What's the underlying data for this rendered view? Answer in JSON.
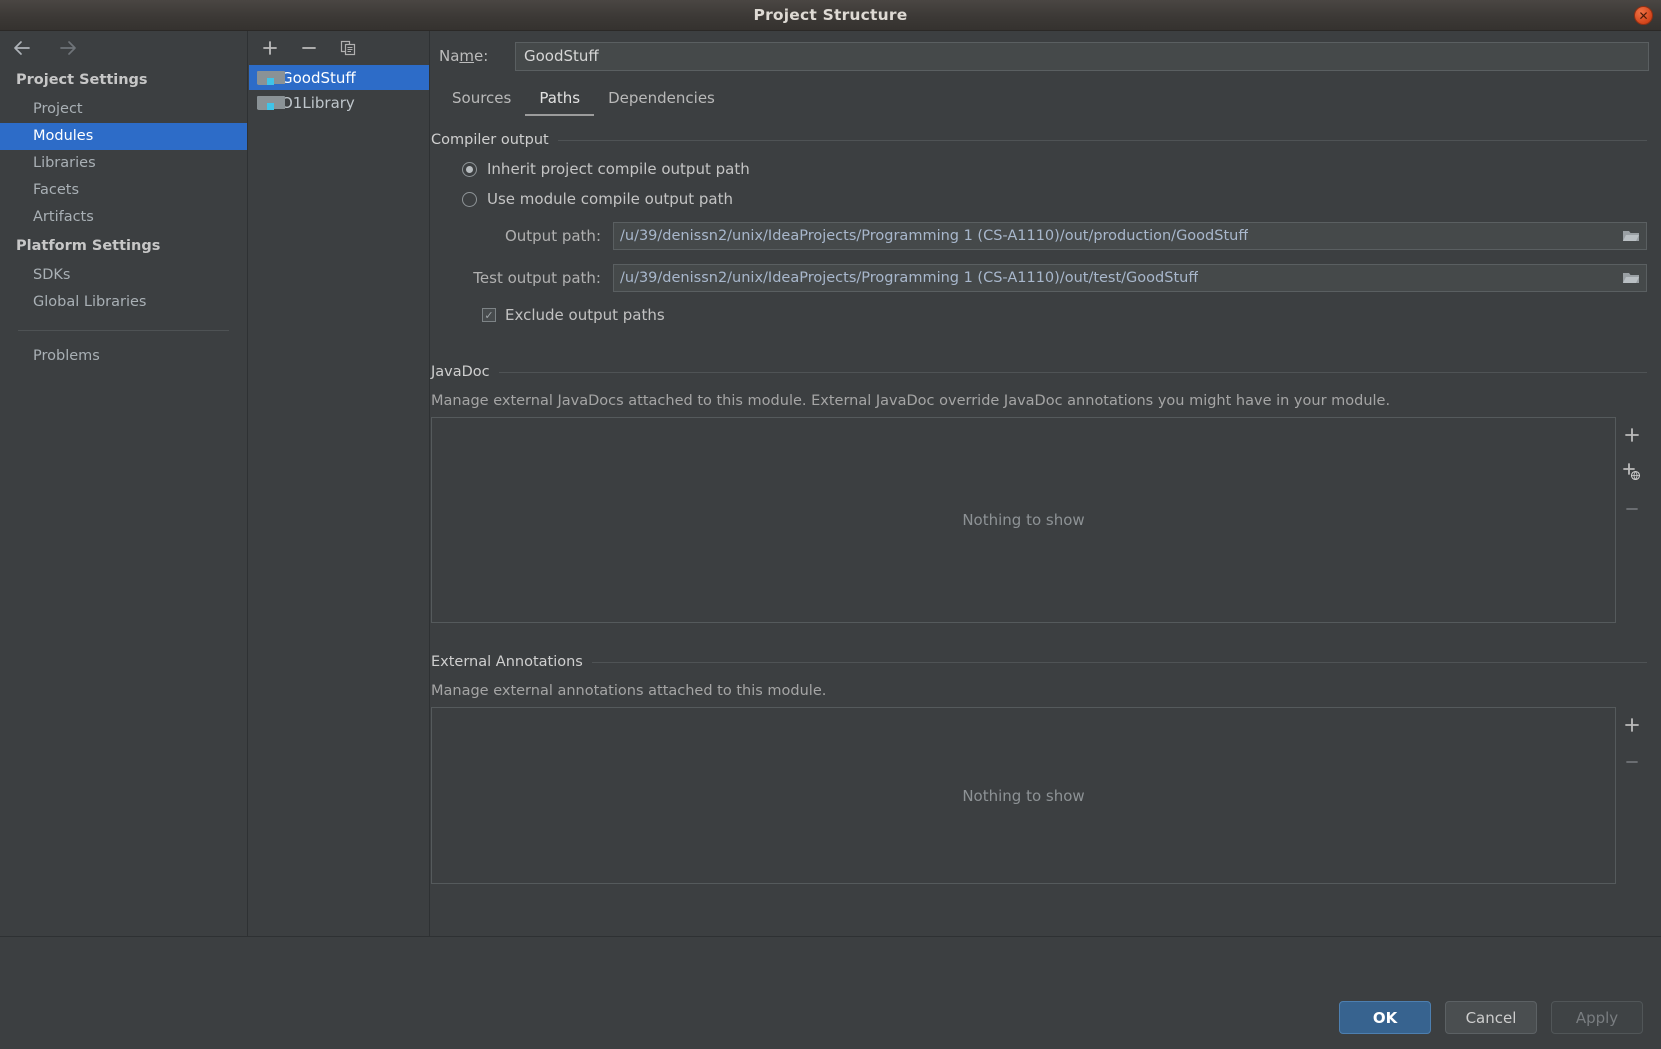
{
  "window": {
    "title": "Project Structure",
    "close_icon": "close-icon"
  },
  "sidebar": {
    "back_icon": "back-arrow-icon",
    "forward_icon": "forward-arrow-icon",
    "groups": [
      {
        "title": "Project Settings",
        "items": [
          "Project",
          "Modules",
          "Libraries",
          "Facets",
          "Artifacts"
        ]
      },
      {
        "title": "Platform Settings",
        "items": [
          "SDKs",
          "Global Libraries"
        ]
      }
    ],
    "extra_items": [
      "Problems"
    ],
    "selected": "Modules",
    "help_label": "?"
  },
  "modules_panel": {
    "toolbar": [
      {
        "name": "add-module-button",
        "glyph": "+"
      },
      {
        "name": "remove-module-button",
        "glyph": "−"
      },
      {
        "name": "copy-module-button",
        "glyph": "copy-icon"
      }
    ],
    "modules": [
      {
        "name": "GoodStuff",
        "selected": true
      },
      {
        "name": "O1Library",
        "selected": false
      }
    ]
  },
  "main": {
    "name_label_pre": "Na",
    "name_label_mnemonic": "m",
    "name_label_post": "e:",
    "name_value": "GoodStuff",
    "tabs": [
      {
        "label": "Sources",
        "active": false
      },
      {
        "label": "Paths",
        "active": true
      },
      {
        "label": "Dependencies",
        "active": false
      }
    ],
    "compiler_output": {
      "title": "Compiler output",
      "radio_inherit": "Inherit project compile output path",
      "radio_module": "Use module compile output path",
      "selected_radio": "inherit",
      "output_path_label": "Output path:",
      "output_path_value": "/u/39/denissn2/unix/IdeaProjects/Programming 1 (CS-A1110)/out/production/GoodStuff",
      "test_output_path_label": "Test output path:",
      "test_output_path_value": "/u/39/denissn2/unix/IdeaProjects/Programming 1 (CS-A1110)/out/test/GoodStuff",
      "exclude_label": "Exclude output paths",
      "exclude_checked": true,
      "browse_icon": "folder-browse-icon"
    },
    "javadoc": {
      "title": "JavaDoc",
      "description": "Manage external JavaDocs attached to this module. External JavaDoc override JavaDoc annotations you might have in your module.",
      "empty_text": "Nothing to show",
      "tools": [
        {
          "name": "add-javadoc-button",
          "glyph": "+",
          "disabled": false
        },
        {
          "name": "add-javadoc-url-button",
          "glyph": "add-url-icon",
          "disabled": false
        },
        {
          "name": "remove-javadoc-button",
          "glyph": "−",
          "disabled": true
        }
      ]
    },
    "external_annotations": {
      "title": "External Annotations",
      "description": "Manage external annotations attached to this module.",
      "empty_text": "Nothing to show",
      "tools": [
        {
          "name": "add-annotation-button",
          "glyph": "+",
          "disabled": false
        },
        {
          "name": "remove-annotation-button",
          "glyph": "−",
          "disabled": true
        }
      ]
    }
  },
  "footer": {
    "ok": "OK",
    "cancel": "Cancel",
    "apply": "Apply",
    "apply_disabled": true
  },
  "colors": {
    "accent": "#2d6cc8",
    "primary_button": "#37638f",
    "background": "#3c3f41",
    "path_text": "#a8b7cc"
  }
}
